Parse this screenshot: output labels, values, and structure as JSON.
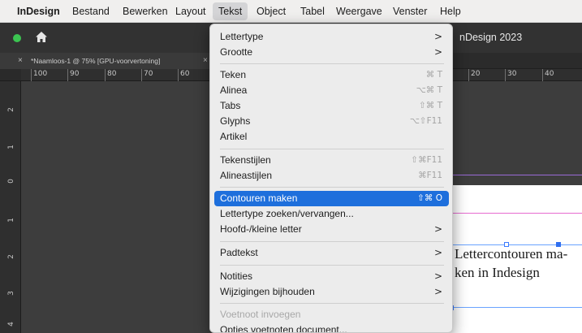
{
  "menubar": {
    "items": [
      "InDesign",
      "Bestand",
      "Bewerken",
      "Layout",
      "Tekst",
      "Object",
      "Tabel",
      "Weergave",
      "Venster",
      "Help"
    ]
  },
  "appbar": {
    "title": "nDesign 2023",
    "icons": [
      "status-dot",
      "home-icon"
    ]
  },
  "tab": {
    "close_glyph": "×",
    "label": "*Naamloos-1 @ 75% [GPU-voorvertoning]",
    "close2_glyph": "×"
  },
  "ruler": {
    "horizontal": [
      "100",
      "90",
      "80",
      "70",
      "60",
      "20",
      "30",
      "40"
    ],
    "vertical": [
      "2",
      "1",
      "0",
      "1",
      "2",
      "3",
      "4"
    ]
  },
  "menu": {
    "lettertype": {
      "label": "Lettertype",
      "arrow": ">"
    },
    "grootte": {
      "label": "Grootte",
      "arrow": ">"
    },
    "teken": {
      "label": "Teken",
      "shortcut": "⌘ T"
    },
    "alinea": {
      "label": "Alinea",
      "shortcut": "⌥⌘ T"
    },
    "tabs": {
      "label": "Tabs",
      "shortcut": "⇧⌘ T"
    },
    "glyphs": {
      "label": "Glyphs",
      "shortcut": "⌥⇧F11"
    },
    "artikel": {
      "label": "Artikel"
    },
    "tekenstijlen": {
      "label": "Tekenstijlen",
      "shortcut": "⇧⌘F11"
    },
    "alineastijlen": {
      "label": "Alineastijlen",
      "shortcut": "⌘F11"
    },
    "contouren": {
      "label": "Contouren maken",
      "shortcut": "⇧⌘ O"
    },
    "zoeken": {
      "label": "Lettertype zoeken/vervangen..."
    },
    "hoofd": {
      "label": "Hoofd-/kleine letter",
      "arrow": ">"
    },
    "padtekst": {
      "label": "Padtekst",
      "arrow": ">"
    },
    "notities": {
      "label": "Notities",
      "arrow": ">"
    },
    "wijzigingen": {
      "label": "Wijzigingen bijhouden",
      "arrow": ">"
    },
    "voetnoot": {
      "label": "Voetnoot invoegen"
    },
    "opties": {
      "label": "Opties voetnoten document..."
    }
  },
  "document": {
    "line1": "Lettercontouren ma-",
    "line2": "ken in Indesign"
  },
  "colors": {
    "highlight": "#1e6fdc",
    "status_dot": "#3bc451",
    "guide_pink": "#e66bd0",
    "frame_blue": "#6aa3ff"
  }
}
